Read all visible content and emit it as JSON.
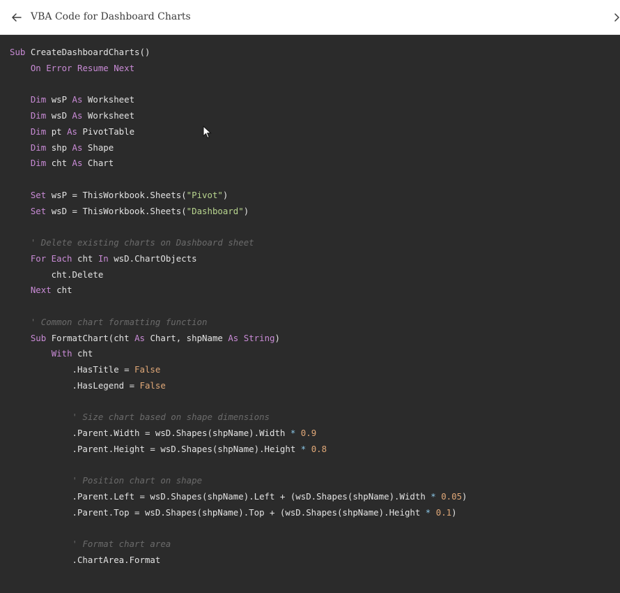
{
  "header": {
    "title": "VBA Code for Dashboard Charts",
    "back_icon": "arrow-left-icon",
    "forward_icon": "chevron-right-icon"
  },
  "colors": {
    "keyword": "#c98bd6",
    "string": "#b9d68f",
    "number": "#e0a878",
    "operator": "#8ac6e6",
    "comment": "#6b6b6b",
    "text": "#e3e3e3",
    "background": "#2b2b2b"
  },
  "code_lines": [
    [
      [
        "kw",
        "Sub"
      ],
      [
        "pl",
        " CreateDashboardCharts()"
      ]
    ],
    [
      [
        "pl",
        "    "
      ],
      [
        "kw",
        "On Error Resume Next"
      ]
    ],
    [],
    [
      [
        "pl",
        "    "
      ],
      [
        "kw",
        "Dim"
      ],
      [
        "pl",
        " wsP "
      ],
      [
        "kw",
        "As"
      ],
      [
        "pl",
        " Worksheet"
      ]
    ],
    [
      [
        "pl",
        "    "
      ],
      [
        "kw",
        "Dim"
      ],
      [
        "pl",
        " wsD "
      ],
      [
        "kw",
        "As"
      ],
      [
        "pl",
        " Worksheet"
      ]
    ],
    [
      [
        "pl",
        "    "
      ],
      [
        "kw",
        "Dim"
      ],
      [
        "pl",
        " pt "
      ],
      [
        "kw",
        "As"
      ],
      [
        "pl",
        " PivotTable"
      ]
    ],
    [
      [
        "pl",
        "    "
      ],
      [
        "kw",
        "Dim"
      ],
      [
        "pl",
        " shp "
      ],
      [
        "kw",
        "As"
      ],
      [
        "pl",
        " Shape"
      ]
    ],
    [
      [
        "pl",
        "    "
      ],
      [
        "kw",
        "Dim"
      ],
      [
        "pl",
        " cht "
      ],
      [
        "kw",
        "As"
      ],
      [
        "pl",
        " Chart"
      ]
    ],
    [],
    [
      [
        "pl",
        "    "
      ],
      [
        "kw",
        "Set"
      ],
      [
        "pl",
        " wsP = ThisWorkbook.Sheets("
      ],
      [
        "str",
        "\"Pivot\""
      ],
      [
        "pl",
        ")"
      ]
    ],
    [
      [
        "pl",
        "    "
      ],
      [
        "kw",
        "Set"
      ],
      [
        "pl",
        " wsD = ThisWorkbook.Sheets("
      ],
      [
        "str",
        "\"Dashboard\""
      ],
      [
        "pl",
        ")"
      ]
    ],
    [],
    [
      [
        "pl",
        "    "
      ],
      [
        "cm",
        "' Delete existing charts on Dashboard sheet"
      ]
    ],
    [
      [
        "pl",
        "    "
      ],
      [
        "kw",
        "For Each"
      ],
      [
        "pl",
        " cht "
      ],
      [
        "kw",
        "In"
      ],
      [
        "pl",
        " wsD.ChartObjects"
      ]
    ],
    [
      [
        "pl",
        "        cht.Delete"
      ]
    ],
    [
      [
        "pl",
        "    "
      ],
      [
        "kw",
        "Next"
      ],
      [
        "pl",
        " cht"
      ]
    ],
    [],
    [
      [
        "pl",
        "    "
      ],
      [
        "cm",
        "' Common chart formatting function"
      ]
    ],
    [
      [
        "pl",
        "    "
      ],
      [
        "kw",
        "Sub"
      ],
      [
        "pl",
        " FormatChart(cht "
      ],
      [
        "kw",
        "As"
      ],
      [
        "pl",
        " Chart, shpName "
      ],
      [
        "kw",
        "As"
      ],
      [
        "pl",
        " "
      ],
      [
        "kw",
        "String"
      ],
      [
        "pl",
        ")"
      ]
    ],
    [
      [
        "pl",
        "        "
      ],
      [
        "kw",
        "With"
      ],
      [
        "pl",
        " cht"
      ]
    ],
    [
      [
        "pl",
        "            .HasTitle = "
      ],
      [
        "num",
        "False"
      ]
    ],
    [
      [
        "pl",
        "            .HasLegend = "
      ],
      [
        "num",
        "False"
      ]
    ],
    [],
    [
      [
        "pl",
        "            "
      ],
      [
        "cm",
        "' Size chart based on shape dimensions"
      ]
    ],
    [
      [
        "pl",
        "            .Parent.Width = wsD.Shapes(shpName).Width "
      ],
      [
        "op",
        "*"
      ],
      [
        "pl",
        " "
      ],
      [
        "num",
        "0.9"
      ]
    ],
    [
      [
        "pl",
        "            .Parent.Height = wsD.Shapes(shpName).Height "
      ],
      [
        "op",
        "*"
      ],
      [
        "pl",
        " "
      ],
      [
        "num",
        "0.8"
      ]
    ],
    [],
    [
      [
        "pl",
        "            "
      ],
      [
        "cm",
        "' Position chart on shape"
      ]
    ],
    [
      [
        "pl",
        "            .Parent.Left = wsD.Shapes(shpName).Left + (wsD.Shapes(shpName).Width "
      ],
      [
        "op",
        "*"
      ],
      [
        "pl",
        " "
      ],
      [
        "num",
        "0.05"
      ],
      [
        "pl",
        ")"
      ]
    ],
    [
      [
        "pl",
        "            .Parent.Top = wsD.Shapes(shpName).Top + (wsD.Shapes(shpName).Height "
      ],
      [
        "op",
        "*"
      ],
      [
        "pl",
        " "
      ],
      [
        "num",
        "0.1"
      ],
      [
        "pl",
        ")"
      ]
    ],
    [],
    [
      [
        "pl",
        "            "
      ],
      [
        "cm",
        "' Format chart area"
      ]
    ],
    [
      [
        "pl",
        "            .ChartArea.Format"
      ]
    ]
  ]
}
